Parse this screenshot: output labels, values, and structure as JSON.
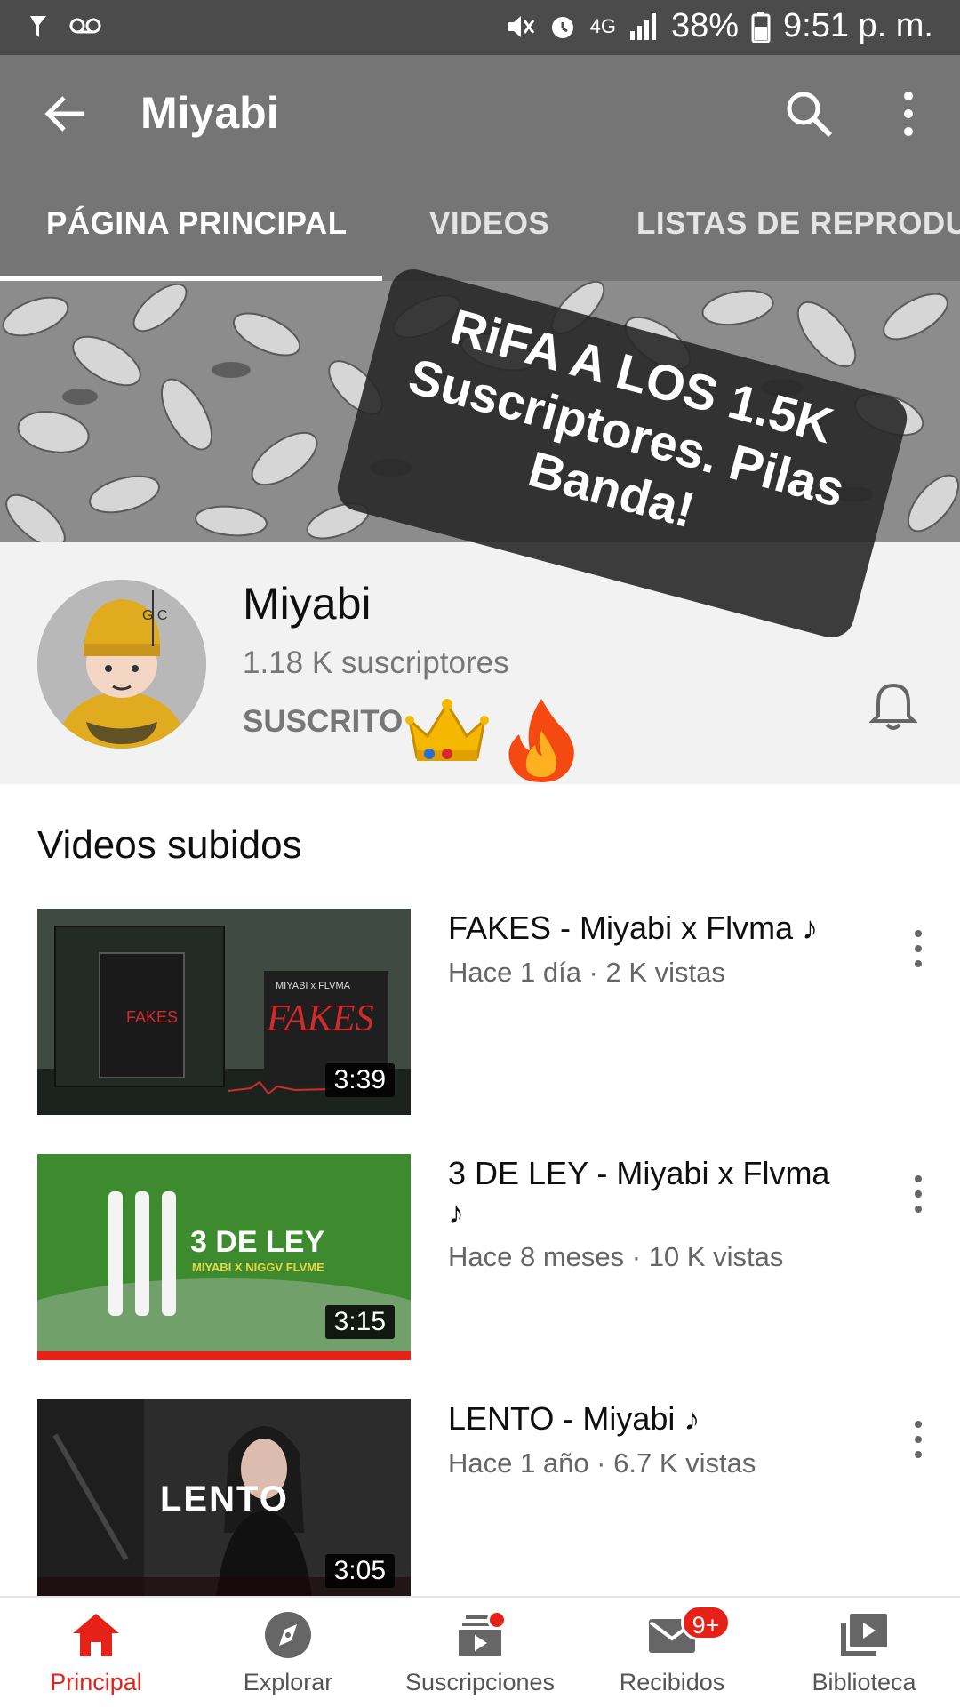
{
  "status_bar": {
    "battery_percent": "38%",
    "time": "9:51 p. m.",
    "network": "4G"
  },
  "app_bar": {
    "title": "Miyabi"
  },
  "tabs": [
    {
      "label": "PÁGINA PRINCIPAL",
      "active": true
    },
    {
      "label": "VIDEOS",
      "active": false
    },
    {
      "label": "LISTAS DE REPRODUC",
      "active": false
    }
  ],
  "banner": {
    "text": "RiFA A LOS 1.5K Suscriptores. Pilas Banda!"
  },
  "channel": {
    "name": "Miyabi",
    "subscribers": "1.18 K suscriptores",
    "subscribed_label": "SUSCRITO"
  },
  "section": {
    "title": "Videos subidos"
  },
  "videos": [
    {
      "title": "FAKES - Miyabi x Flvma ♪",
      "meta": "Hace 1 día · 2 K vistas",
      "duration": "3:39",
      "thumb_text": "FAKES"
    },
    {
      "title": "3 DE LEY - Miyabi x Flvma ♪",
      "meta": "Hace 8 meses · 10 K vistas",
      "duration": "3:15",
      "thumb_text": "3 DE LEY",
      "thumb_subtext": "MIYABI X NIGGV FLVME",
      "watched": true
    },
    {
      "title": "LENTO - Miyabi ♪",
      "meta": "Hace 1 año · 6.7 K vistas",
      "duration": "3:05",
      "thumb_text": "LENTO"
    }
  ],
  "bottom_nav": [
    {
      "label": "Principal",
      "icon": "home-icon",
      "active": true
    },
    {
      "label": "Explorar",
      "icon": "explore-icon"
    },
    {
      "label": "Suscripciones",
      "icon": "subscriptions-icon"
    },
    {
      "label": "Recibidos",
      "icon": "inbox-icon",
      "badge": "9+"
    },
    {
      "label": "Biblioteca",
      "icon": "library-icon"
    }
  ],
  "colors": {
    "app_bar": "#757575",
    "status_bar": "#4b4b4b",
    "accent_red": "#e62117"
  }
}
